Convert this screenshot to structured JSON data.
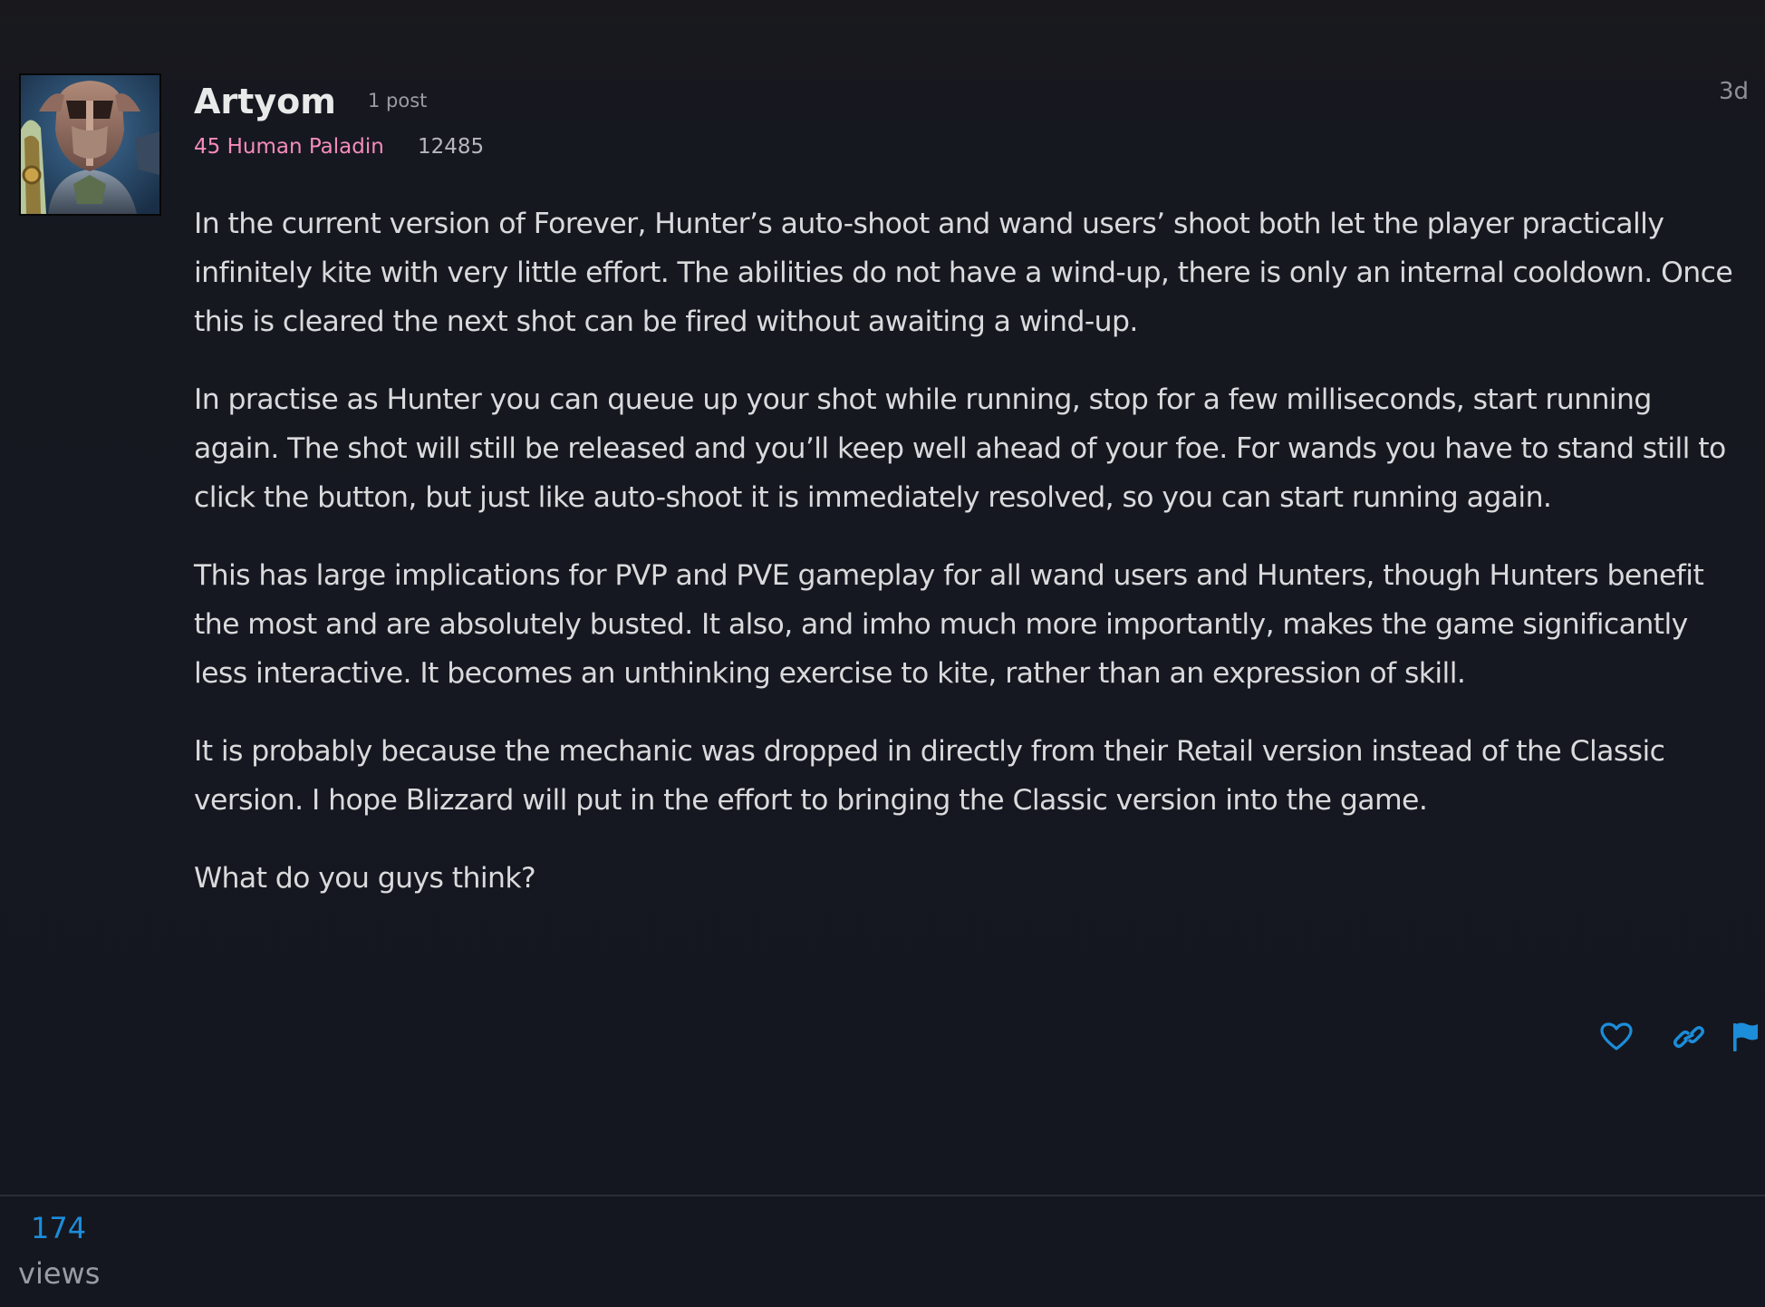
{
  "post": {
    "author": {
      "username": "Artyom",
      "post_count": "1 post",
      "character": "45 Human Paladin",
      "achievement_points": "12485"
    },
    "date": "3d",
    "paragraphs": [
      "In the current version of Forever, Hunter’s auto-shoot and wand users’ shoot both let the player practically infinitely kite with very little effort. The abilities do not have a wind-up, there is only an internal cooldown. Once this is cleared the next shot can be fired without awaiting a wind-up.",
      "In practise as Hunter you can queue up your shot while running, stop for a few milliseconds, start running again. The shot will still be released and you’ll keep well ahead of your foe. For wands you have to stand still to click the button, but just like auto-shoot it is immediately resolved, so you can start running again.",
      "This has large implications for PVP and PVE gameplay for all wand users and Hunters, though Hunters benefit the most and are absolutely busted. It also, and imho much more importantly, makes the game significantly less interactive. It becomes an unthinking exercise to kite, rather than an expression of skill.",
      "It is probably because the mechanic was dropped in directly from their Retail version instead of the Classic version. I hope Blizzard will put in the effort to bringing the Classic version into the game.",
      "What do you guys think?"
    ],
    "actions": {
      "like_icon": "heart-icon",
      "link_icon": "link-icon",
      "flag_icon": "flag-icon"
    }
  },
  "topic_stats": {
    "views_count": "174",
    "views_label": "views"
  },
  "colors": {
    "background": "#161820",
    "class_paladin": "#f58cba",
    "accent_blue": "#1c8dd9",
    "text_primary": "#d9dadc",
    "text_muted": "#9a9ca3"
  }
}
